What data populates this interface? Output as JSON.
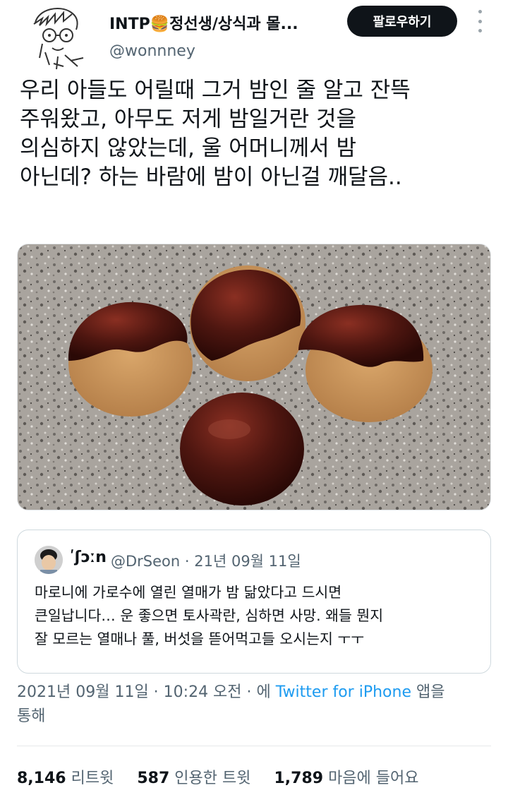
{
  "header": {
    "display_name": "INTP🍔정선생/상식과 몰...",
    "handle": "@wonnney",
    "follow_label": "팔로우하기"
  },
  "tweet": {
    "lines": [
      "우리 아들도 어릴때 그거 밤인 줄 알고 잔뜩",
      "주워왔고, 아무도 저게 밤일거란 것을",
      "의심하지 않았는데, 울 어머니께서 밤",
      "아닌데? 하는 바람에 밤이 아닌걸 깨달음.."
    ]
  },
  "quote": {
    "name": "ʹʃɔːn",
    "meta": "@DrSeon · 21년 09월 11일",
    "lines": [
      "마로니에 가로수에 열린 열매가 밤 닮았다고 드시면",
      "큰일납니다… 운 좋으면 토사곽란, 심하면 사망. 왜들 뭔지",
      "잘 모르는 열매나 풀, 버섯을 뜯어먹고들 오시는지 ㅜㅜ"
    ]
  },
  "timestamp": {
    "prefix": "2021년 09월 11일 · 10:24 오전 · 에 ",
    "source": "Twitter for iPhone",
    "suffix": " 앱을",
    "line2": "통해"
  },
  "stats": [
    {
      "num": "8,146",
      "label": "리트윗"
    },
    {
      "num": "587",
      "label": "인용한 트윗"
    },
    {
      "num": "1,789",
      "label": "마음에 들어요"
    }
  ],
  "colors": {
    "text": "#0f1419",
    "secondary": "#536471",
    "link": "#1d9bf0",
    "button_bg": "#0f1419"
  },
  "icons": [
    "avatar-sketch",
    "more-dots-icon",
    "quote-avatar"
  ]
}
